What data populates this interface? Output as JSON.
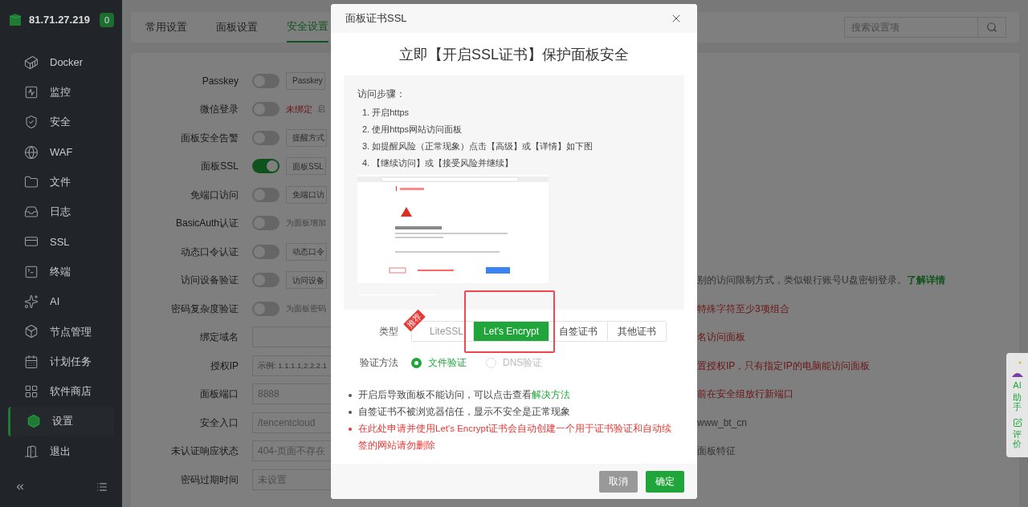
{
  "sidebar": {
    "host": "81.71.27.219",
    "badge": "0",
    "items": [
      {
        "label": "Docker",
        "selected": false
      },
      {
        "label": "监控",
        "selected": false
      },
      {
        "label": "安全",
        "selected": false
      },
      {
        "label": "WAF",
        "selected": false
      },
      {
        "label": "文件",
        "selected": false
      },
      {
        "label": "日志",
        "selected": false
      },
      {
        "label": "SSL",
        "selected": false
      },
      {
        "label": "终端",
        "selected": false
      },
      {
        "label": "AI",
        "selected": false
      },
      {
        "label": "节点管理",
        "selected": false
      },
      {
        "label": "计划任务",
        "selected": false
      },
      {
        "label": "软件商店",
        "selected": false
      },
      {
        "label": "设置",
        "selected": true
      },
      {
        "label": "退出",
        "selected": false
      }
    ]
  },
  "tabs": [
    {
      "label": "常用设置",
      "selected": false
    },
    {
      "label": "面板设置",
      "selected": false
    },
    {
      "label": "安全设置",
      "selected": true
    }
  ],
  "search": {
    "placeholder": "搜索设置项"
  },
  "settings": [
    {
      "label": "Passkey",
      "kind": "toggle",
      "on": false,
      "extra": {
        "kind": "button",
        "text": "Passkey"
      }
    },
    {
      "label": "微信登录",
      "kind": "toggle",
      "on": false,
      "extra": {
        "kind": "status",
        "text": "未绑定",
        "hint": "启"
      }
    },
    {
      "label": "面板安全告警",
      "kind": "toggle",
      "on": false,
      "extra": {
        "kind": "button",
        "text": "提醒方式"
      }
    },
    {
      "label": "面板SSL",
      "kind": "toggle",
      "on": true,
      "extra": {
        "kind": "button",
        "text": "面板SSL"
      }
    },
    {
      "label": "免端口访问",
      "kind": "toggle",
      "on": false,
      "extra": {
        "kind": "button",
        "text": "免端口访"
      }
    },
    {
      "label": "BasicAuth认证",
      "kind": "toggle",
      "on": false,
      "extra": {
        "kind": "text",
        "text": "为面板增加"
      }
    },
    {
      "label": "动态口令认证",
      "kind": "toggle",
      "on": false,
      "extra": {
        "kind": "button",
        "text": "动态口令"
      }
    },
    {
      "label": "访问设备验证",
      "kind": "toggle",
      "on": false,
      "extra": {
        "kind": "button",
        "text": "访问设备"
      },
      "note": {
        "text": "别的访问限制方式，类似银行账号U盘密钥登录。",
        "link": "了解详情",
        "kind": "plain"
      }
    },
    {
      "label": "密码复杂度验证",
      "kind": "toggle",
      "on": false,
      "extra": {
        "kind": "text",
        "text": "为面板密码"
      },
      "note": {
        "text": "特殊字符至少3项组合",
        "kind": "warning"
      }
    },
    {
      "label": "绑定域名",
      "kind": "input",
      "note": {
        "text": "名访问面板",
        "kind": "warning"
      }
    },
    {
      "label": "授权IP",
      "kind": "input",
      "placeholder": "示例: 1.1.1.1,2.2.2.1",
      "note": {
        "text": "置授权IP，只有指定IP的电脑能访问面板",
        "kind": "warning"
      }
    },
    {
      "label": "面板端口",
      "kind": "input",
      "value": "8888",
      "note": {
        "text": "前在安全组放行新端口",
        "kind": "warning"
      }
    },
    {
      "label": "安全入口",
      "kind": "input",
      "value": "/tencentcloud",
      "note": {
        "text": "www_bt_cn",
        "kind": "plain"
      }
    },
    {
      "label": "未认证响应状态",
      "kind": "input",
      "value": "404-页面不存在",
      "note": {
        "text": "面板特征",
        "kind": "plain"
      }
    },
    {
      "label": "密码过期时间",
      "kind": "input",
      "value": "未设置"
    }
  ],
  "float_widget": {
    "ai_label": "AI",
    "ai_chars": "助手",
    "review": "评价"
  },
  "modal": {
    "title": "面板证书SSL",
    "heading": "立即【开启SSL证书】保护面板安全",
    "steps_title": "访问步骤：",
    "steps": [
      "1. 开启https",
      "2. 使用https网站访问面板",
      "3. 如提醒风险（正常现象）点击【高级】或【详情】如下图",
      "4. 【继续访问】或【接受风险并继续】"
    ],
    "type_label": "类型",
    "types": [
      {
        "label": "LiteSSL",
        "selected": false,
        "disabled": true,
        "ribbon": "推荐"
      },
      {
        "label": "Let's Encrypt",
        "selected": true,
        "disabled": false
      },
      {
        "label": "自签证书",
        "selected": false,
        "disabled": false
      },
      {
        "label": "其他证书",
        "selected": false,
        "disabled": false
      }
    ],
    "method_label": "验证方法",
    "methods": [
      {
        "label": "文件验证",
        "selected": true
      },
      {
        "label": "DNS验证",
        "selected": false
      }
    ],
    "notes": [
      {
        "text": "开启后导致面板不能访问，可以点击查看",
        "link": "解决方法",
        "kind": "plain"
      },
      {
        "text": "自签证书不被浏览器信任，显示不安全是正常现象",
        "kind": "plain"
      },
      {
        "text": "在此处申请并使用Let's Encrypt证书会自动创建一个用于证书验证和自动续签的网站请勿删除",
        "kind": "warning"
      }
    ],
    "buttons": [
      {
        "label": "取消",
        "kind": "secondary"
      },
      {
        "label": "确定",
        "kind": "primary"
      }
    ]
  }
}
